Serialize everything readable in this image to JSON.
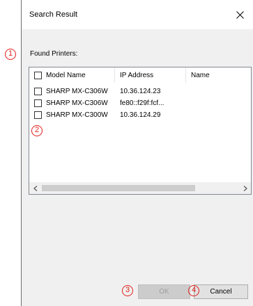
{
  "dialog": {
    "title": "Search Result",
    "close_icon": "close-icon"
  },
  "found_printers_label": "Found Printers:",
  "table": {
    "columns": [
      "Model Name",
      "IP Address",
      "Name"
    ],
    "rows": [
      {
        "model": "SHARP MX-C306W",
        "ip": "10.36.124.23"
      },
      {
        "model": "SHARP MX-C306W",
        "ip": "fe80::f29f:fcf..."
      },
      {
        "model": "SHARP MX-C300W",
        "ip": "10.36.124.29"
      }
    ]
  },
  "buttons": {
    "ok": "OK",
    "cancel": "Cancel"
  },
  "markers": [
    "1",
    "2",
    "3",
    "4"
  ],
  "colors": {
    "marker": "#e0201b",
    "dialog_bg": "#f0f0f0",
    "title_bg": "#ffffff"
  }
}
